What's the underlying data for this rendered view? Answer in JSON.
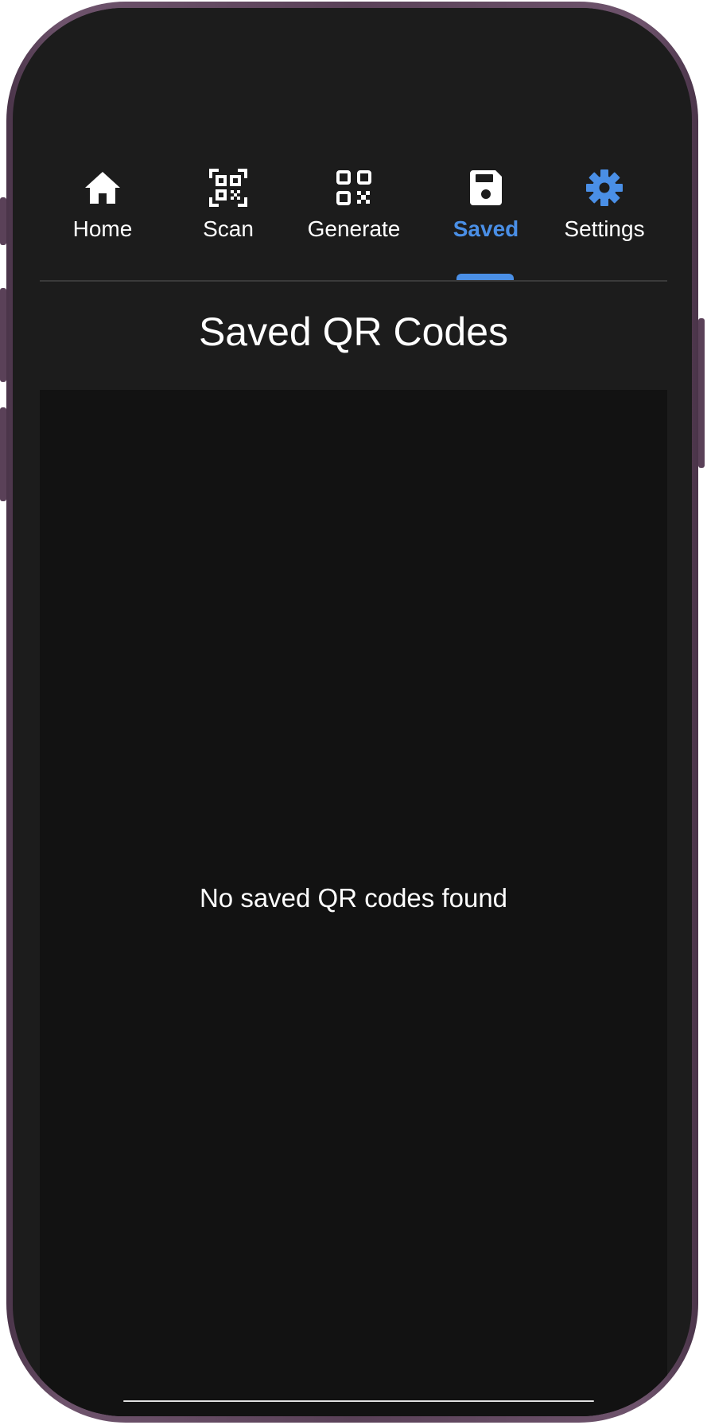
{
  "tabs": [
    {
      "label": "Home",
      "icon": "home-icon",
      "active": false
    },
    {
      "label": "Scan",
      "icon": "qr-scan-icon",
      "active": false
    },
    {
      "label": "Generate",
      "icon": "qr-code-icon",
      "active": false
    },
    {
      "label": "Saved",
      "icon": "save-icon",
      "active": true
    },
    {
      "label": "Settings",
      "icon": "gear-icon",
      "active": false
    }
  ],
  "page": {
    "title": "Saved QR Codes",
    "empty_message": "No saved QR codes found"
  },
  "colors": {
    "accent": "#4a8fe6",
    "background": "#121212",
    "surface": "#1c1c1c",
    "text": "#ffffff",
    "device_frame": "#5a4158"
  }
}
